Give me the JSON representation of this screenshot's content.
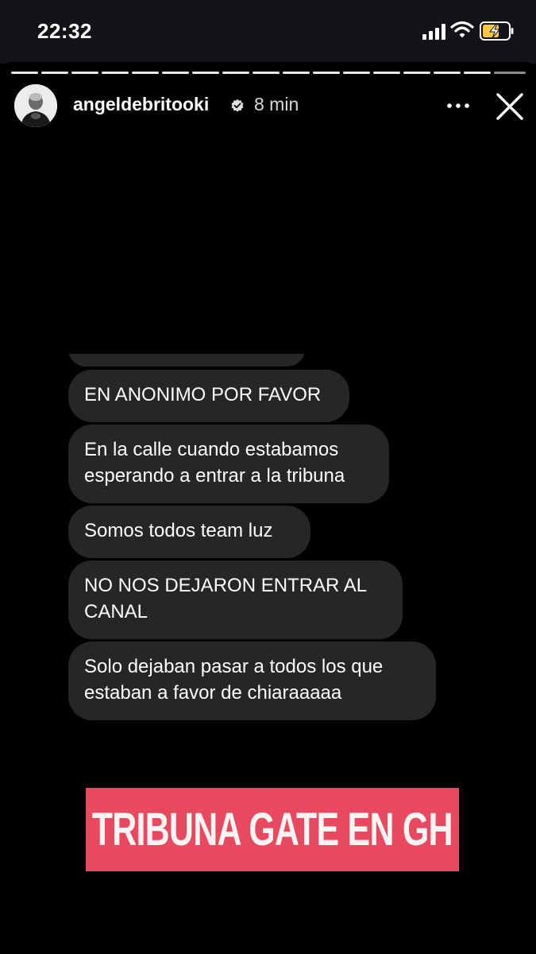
{
  "status_bar": {
    "time": "22:32"
  },
  "story": {
    "progress_segments": 17,
    "username": "angeldebritooki",
    "verified": true,
    "time_ago": "8 min",
    "more_icon": "more-horizontal-icon",
    "close_icon": "close-icon"
  },
  "messages": [
    {
      "text": "EN ANONIMO POR FAVOR"
    },
    {
      "text": "En la calle cuando estabamos esperando a entrar a la tribuna"
    },
    {
      "text": "Somos todos team luz"
    },
    {
      "text": "NO NOS DEJARON ENTRAR AL CANAL"
    },
    {
      "text": "Solo dejaban pasar a todos los que estaban a favor de chiaraaaaa"
    }
  ],
  "banner": {
    "text": "TRIBUNA GATE EN GH",
    "color": "#e8495e"
  }
}
